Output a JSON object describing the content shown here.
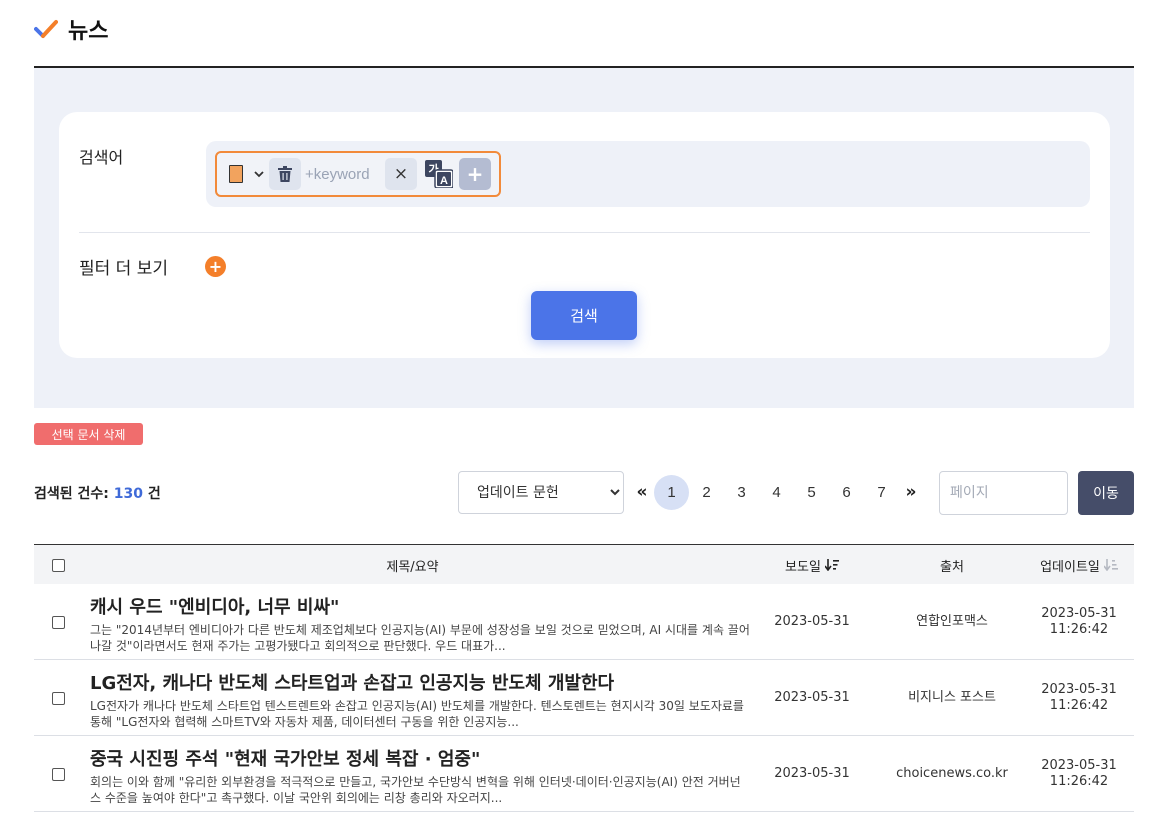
{
  "header": {
    "title": "뉴스"
  },
  "search": {
    "keyword_label": "검색어",
    "keyword_placeholder": "+keyword",
    "clear_symbol": "×",
    "add_symbol": "+",
    "translate_glyph_top": "가",
    "translate_glyph_bottom": "A",
    "filter_label": "필터 더 보기",
    "filter_plus": "+",
    "search_button": "검색"
  },
  "actions": {
    "delete_selected": "선택 문서 삭제"
  },
  "results": {
    "count_label": "검색된 건수:",
    "count_value": "130",
    "count_unit": "건"
  },
  "sort": {
    "selected": "업데이트 문헌"
  },
  "pagination": {
    "first": "«",
    "last": "»",
    "pages": [
      "1",
      "2",
      "3",
      "4",
      "5",
      "6",
      "7"
    ],
    "current": "1",
    "page_placeholder": "페이지",
    "go_button": "이동"
  },
  "table": {
    "headers": {
      "title": "제목/요약",
      "date": "보도일",
      "source": "출처",
      "updated": "업데이트일"
    },
    "rows": [
      {
        "title": "캐시 우드 \"엔비디아, 너무 비싸\"",
        "summary": "그는 \"2014년부터 엔비디아가 다른 반도체 제조업체보다 인공지능(AI) 부문에 성장성을 보일 것으로 믿었으며, AI 시대를 계속 끌어나갈 것\"이라면서도 현재 주가는 고평가됐다고 회의적으로 판단했다. 우드 대표가...",
        "date": "2023-05-31",
        "source": "연합인포맥스",
        "updated_date": "2023-05-31",
        "updated_time": "11:26:42"
      },
      {
        "title": "LG전자, 캐나다 반도체 스타트업과 손잡고 인공지능 반도체 개발한다",
        "summary": "LG전자가 캐나다 반도체 스타트업 텐스트렌트와 손잡고 인공지능(AI) 반도체를 개발한다. 텐스토렌트는 현지시각 30일 보도자료를 통해 \"LG전자와 협력해 스마트TV와 자동차 제품, 데이터센터 구동을 위한 인공지능...",
        "date": "2023-05-31",
        "source": "비지니스 포스트",
        "updated_date": "2023-05-31",
        "updated_time": "11:26:42"
      },
      {
        "title": "중국 시진핑 주석 \"현재 국가안보 정세 복잡 · 엄중\"",
        "summary": "회의는 이와 함께 \"유리한 외부환경을 적극적으로 만들고, 국가안보 수단방식 변혁을 위해 인터넷·데이터·인공지능(AI) 안전 거버넌스 수준을 높여야 한다\"고 촉구했다. 이날 국안위 회의에는 리창 총리와 자오러지...",
        "date": "2023-05-31",
        "source": "choicenews.co.kr",
        "updated_date": "2023-05-31",
        "updated_time": "11:26:42"
      }
    ]
  },
  "colors": {
    "accent_blue": "#4b74e8",
    "accent_orange": "#f47f2a",
    "delete_red": "#f06d6d",
    "go_button": "#454d69",
    "panel_bg": "#eef1f8"
  }
}
